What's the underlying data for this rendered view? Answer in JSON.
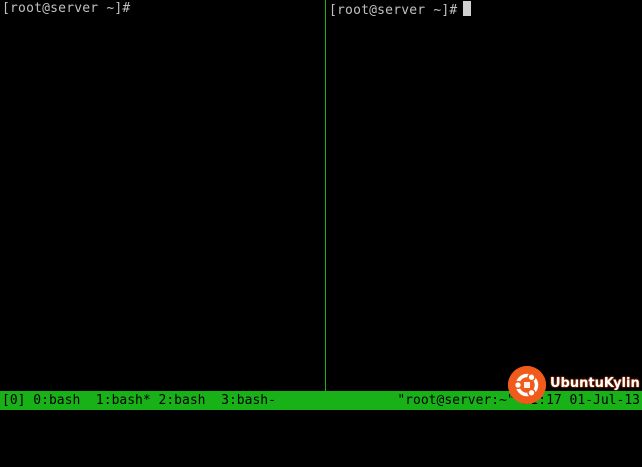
{
  "panes": {
    "left": {
      "prompt": "[root@server ~]#"
    },
    "right": {
      "prompt": "[root@server ~]#"
    }
  },
  "statusbar": {
    "left": "[0] 0:bash  1:bash* 2:bash  3:bash-",
    "right": "\"root@server:~\" 21:17 01-Jul-13"
  },
  "watermark": {
    "text": "UbuntuKylin",
    "icon": "ubuntu-kylin-logo"
  },
  "colors": {
    "background": "#000000",
    "text": "#c0c0c0",
    "statusbar": "#18b218",
    "divider": "#19b219",
    "watermark": "#f05a1a"
  }
}
